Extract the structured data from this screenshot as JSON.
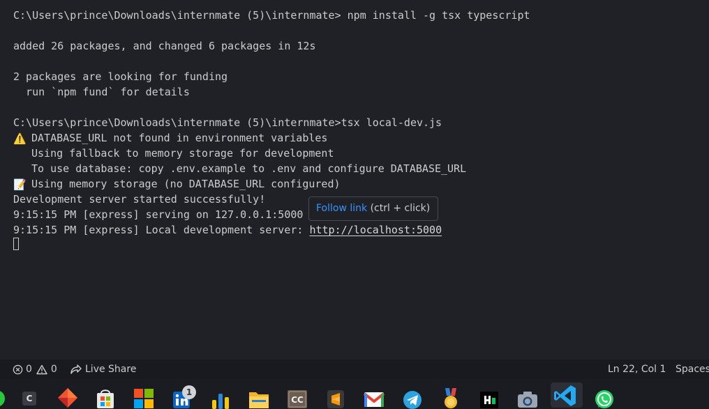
{
  "terminal": {
    "cmd1": "C:\\Users\\prince\\Downloads\\internmate (5)\\internmate> npm install -g tsx typescript",
    "added": "added 26 packages, and changed 6 packages in 12s",
    "funding": "2 packages are looking for funding",
    "fund_hint": "  run `npm fund` for details",
    "cmd2": "C:\\Users\\prince\\Downloads\\internmate (5)\\internmate>tsx local-dev.js",
    "warn_emoji": "⚠️",
    "warn1": "DATABASE_URL not found in environment variables",
    "warn2": "Using fallback to memory storage for development",
    "warn3": "To use database: copy .env.example to .env and configure DATABASE_URL",
    "memo_emoji": "📝",
    "memo": "Using memory storage (no DATABASE_URL configured)",
    "started": "Development server started successfully!",
    "serving": "9:15:15 PM [express] serving on 127.0.0.1:5000",
    "local_prefix": "9:15:15 PM [express] Local development server: ",
    "local_url": "http://localhost:5000"
  },
  "tooltip": {
    "link": "Follow link",
    "hint": " (ctrl + click)"
  },
  "statusbar": {
    "errors": "0",
    "warnings": "0",
    "live_share": "Live Share",
    "position": "Ln 22, Col 1",
    "spaces": "Spaces:"
  },
  "taskbar": {
    "linkedin_badge": "1",
    "c_label": "C",
    "cc_label": "CC"
  },
  "colors": {
    "terminal_bg": "#1f2127",
    "link_blue": "#3794ff",
    "vscode_blue": "#23a9f2"
  }
}
